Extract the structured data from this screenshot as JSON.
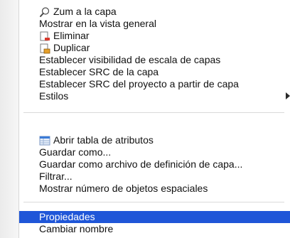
{
  "menu": {
    "zoom_to_layer": "Zum a la capa",
    "show_in_overview": "Mostrar en la vista general",
    "remove": "Eliminar",
    "duplicate": "Duplicar",
    "set_scale_visibility": "Establecer visibilidad de escala de capas",
    "set_layer_crs": "Establecer SRC de la capa",
    "set_project_crs": "Establecer SRC del proyecto a partir de capa",
    "styles": "Estilos",
    "open_attribute_table": "Abrir tabla de atributos",
    "save_as": "Guardar como...",
    "save_as_definition": "Guardar como archivo de definición de capa...",
    "filter": "Filtrar...",
    "show_feature_count": "Mostrar número de objetos espaciales",
    "properties": "Propiedades",
    "rename": "Cambiar nombre"
  },
  "icons": {
    "zoom": "magnifier-icon",
    "remove": "remove-layer-icon",
    "duplicate": "duplicate-layer-icon",
    "attribute_table": "table-icon",
    "styles_submenu": "chevron-right-icon"
  },
  "colors": {
    "selection": "#1f56d8",
    "remove_accent": "#d83a2e",
    "duplicate_accent": "#e6a02a",
    "table_accent": "#3b7bd6"
  }
}
